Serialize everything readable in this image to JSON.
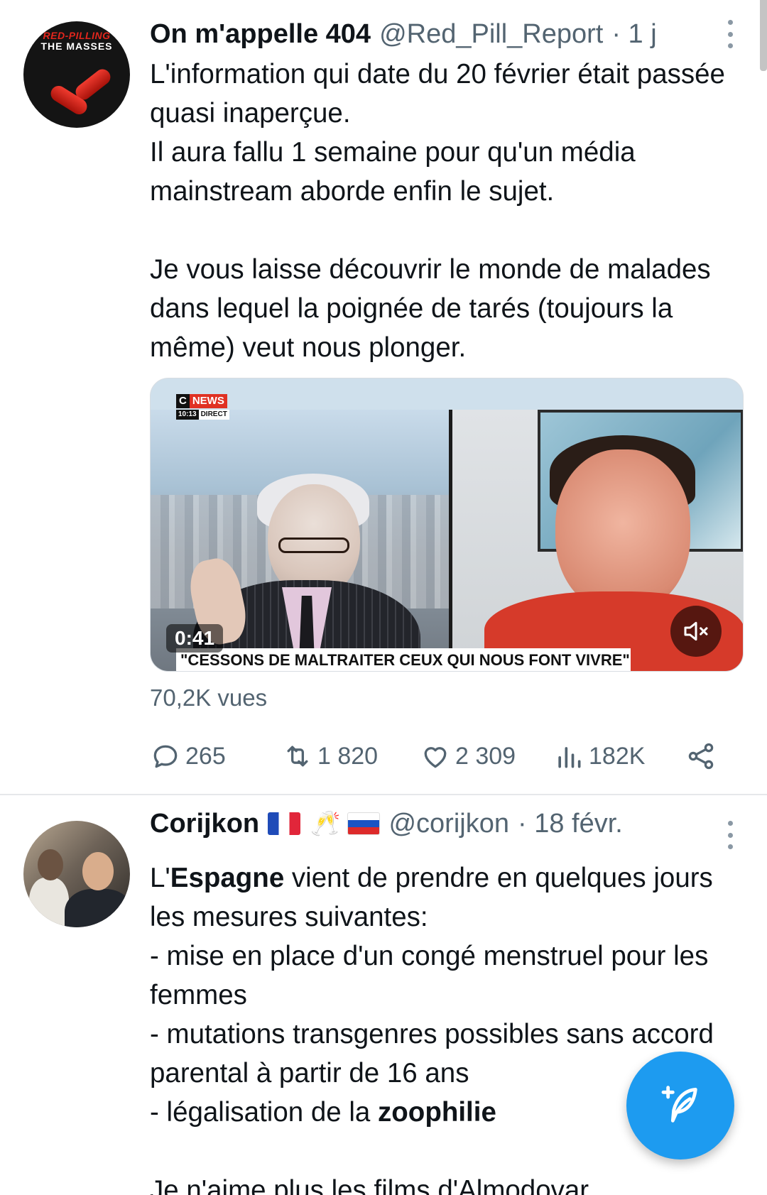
{
  "tweets": [
    {
      "author": {
        "name": "On m'appelle 404",
        "handle": "@Red_Pill_Report",
        "time": "· 1 j",
        "avatar_text_1": "RED-PILLING",
        "avatar_text_2": "THE MASSES"
      },
      "paragraphs": [
        "L'information qui date du 20 février était passée quasi inaperçue.",
        "Il aura fallu 1 semaine pour qu'un média mainstream aborde enfin le sujet.",
        "",
        "Je vous laisse découvrir le monde de malades dans lequel la poignée de tarés (toujours la même) veut nous plonger."
      ],
      "video": {
        "channel_c": "C",
        "channel_news": "NEWS",
        "clock": "10:13",
        "live_label": "DIRECT",
        "caption": "\"CESSONS DE MALTRAITER CEUX QUI NOUS FONT VIVRE\"",
        "duration": "0:41",
        "mute_icon": "speaker-muted-icon"
      },
      "views": "70,2K vues",
      "stats": {
        "replies": "265",
        "retweets": "1 820",
        "likes": "2 309",
        "impressions": "182K"
      }
    },
    {
      "author": {
        "name": "Corijkon",
        "emoji_flag_1": "flag-france",
        "emoji_glasses": "🥂",
        "emoji_flag_2": "flag-russia",
        "handle": "@corijkon",
        "time": "· 18 févr."
      },
      "lines": {
        "l1_pre": "L'",
        "l1_bold": "Espagne",
        "l1_post": " vient de prendre en quelques jours les mesures suivantes:",
        "l2": "- mise en place d'un congé menstruel pour les femmes",
        "l3": "- mutations transgenres possibles sans accord parental à partir de 16 ans",
        "l4_pre": "- légalisation de la ",
        "l4_bold": "zoophilie",
        "l5": "Je n'aime plus les films d'Almodovar"
      }
    }
  ],
  "fab": {
    "icon": "compose-tweet-icon"
  },
  "colors": {
    "accent": "#1d9bf0",
    "muted": "#536471",
    "text": "#0f1419"
  }
}
